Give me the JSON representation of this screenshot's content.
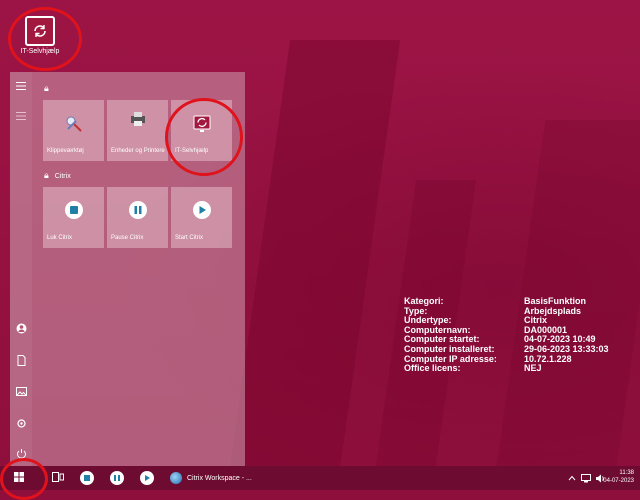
{
  "desktop": {
    "icon_label": "IT-Selvhjælp",
    "accent": "#e0121b"
  },
  "start_menu": {
    "groups": [
      {
        "label": "",
        "tiles": [
          {
            "label": "Klippeværktøj",
            "icon": "snipping-tool-icon"
          },
          {
            "label": "Enheder og Printere",
            "icon": "printer-icon"
          },
          {
            "label": "IT-Selvhjælp",
            "icon": "it-selfhelp-icon"
          }
        ]
      },
      {
        "label": "Citrix",
        "tiles": [
          {
            "label": "Luk Citrix",
            "icon": "stop-icon"
          },
          {
            "label": "Pause Citrix",
            "icon": "pause-icon"
          },
          {
            "label": "Start Citrix",
            "icon": "play-icon"
          }
        ]
      }
    ]
  },
  "info": {
    "rows": [
      {
        "key": "Kategori:",
        "value": "BasisFunktion"
      },
      {
        "key": "Type:",
        "value": "Arbejdsplads"
      },
      {
        "key": "Undertype:",
        "value": "Citrix"
      },
      {
        "key": "Computernavn:",
        "value": "DA000001"
      },
      {
        "key": "Computer startet:",
        "value": "04-07-2023 10:49"
      },
      {
        "key": "Computer installeret:",
        "value": "29-06-2023 13:33:03"
      },
      {
        "key": "Computer IP adresse:",
        "value": "10.72.1.228"
      },
      {
        "key": "Office licens:",
        "value": "NEJ"
      }
    ]
  },
  "taskbar": {
    "citrix_workspace_label": "Citrix Workspace - ...",
    "time": "11:38",
    "date": "04-07-2023"
  }
}
